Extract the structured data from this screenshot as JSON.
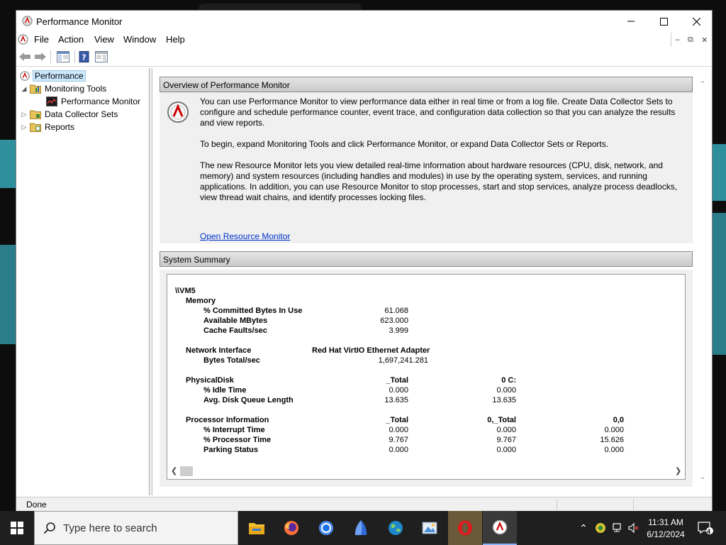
{
  "window": {
    "title": "Performance Monitor"
  },
  "menu": {
    "items": [
      "File",
      "Action",
      "View",
      "Window",
      "Help"
    ]
  },
  "tree": {
    "root": "Performance",
    "monitoring_tools": "Monitoring Tools",
    "performance_monitor": "Performance Monitor",
    "data_collector_sets": "Data Collector Sets",
    "reports": "Reports"
  },
  "overview": {
    "header": "Overview of Performance Monitor",
    "p1": "You can use Performance Monitor to view performance data either in real time or from a log file. Create Data Collector Sets to configure and schedule performance counter, event trace, and configuration data collection so that you can analyze the results and view reports.",
    "p2": "To begin, expand Monitoring Tools and click Performance Monitor, or expand Data Collector Sets or Reports.",
    "p3": "The new Resource Monitor lets you view detailed real-time information about hardware resources (CPU, disk, network, and memory) and system resources (including handles and modules) in use by the operating system, services, and running applications. In addition, you can use Resource Monitor to stop processes, start and stop services, analyze process deadlocks, view thread wait chains, and identify processes locking files.",
    "link": "Open Resource Monitor"
  },
  "summary": {
    "header": "System Summary",
    "machine": "\\\\VM5",
    "memory": {
      "label": "Memory",
      "rows": [
        {
          "name": "% Committed Bytes In Use",
          "value": "61.068"
        },
        {
          "name": "Available MBytes",
          "value": "623.000"
        },
        {
          "name": "Cache Faults/sec",
          "value": "3.999"
        }
      ]
    },
    "network": {
      "label": "Network Interface",
      "adapter": "Red Hat VirtIO Ethernet Adapter",
      "rows": [
        {
          "name": "Bytes Total/sec",
          "value": "1,697,241.281"
        }
      ]
    },
    "disk": {
      "label": "PhysicalDisk",
      "col1": "_Total",
      "col2": "0 C:",
      "rows": [
        {
          "name": "% Idle Time",
          "v1": "0.000",
          "v2": "0.000"
        },
        {
          "name": "Avg. Disk Queue Length",
          "v1": "13.635",
          "v2": "13.635"
        }
      ]
    },
    "processor": {
      "label": "Processor Information",
      "col1": "_Total",
      "col2": "0,_Total",
      "col3": "0,0",
      "rows": [
        {
          "name": "% Interrupt Time",
          "v1": "0.000",
          "v2": "0.000",
          "v3": "0.000"
        },
        {
          "name": "% Processor Time",
          "v1": "9.767",
          "v2": "9.767",
          "v3": "15.626"
        },
        {
          "name": "Parking Status",
          "v1": "0.000",
          "v2": "0.000",
          "v3": "0.000"
        }
      ]
    }
  },
  "status": {
    "text": "Done"
  },
  "taskbar": {
    "search_placeholder": "Type here to search",
    "time": "11:31 AM",
    "date": "6/12/2024",
    "notification_count": "4"
  },
  "colors": {
    "accent": "#0078d7",
    "link": "#0033cc",
    "selection": "#cce8ff"
  }
}
